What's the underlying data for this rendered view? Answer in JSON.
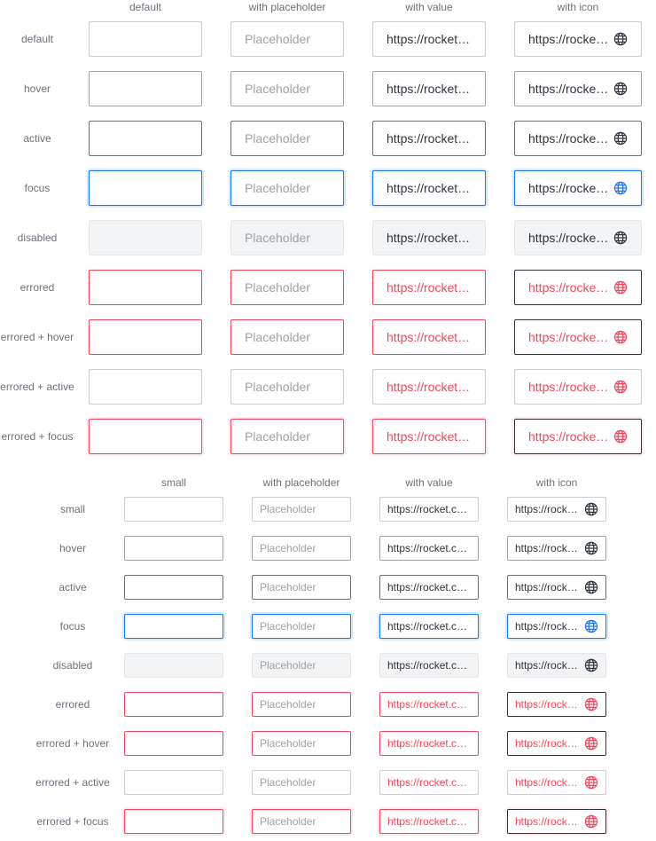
{
  "large": {
    "columns": [
      "default",
      "with placeholder",
      "with value",
      "with icon"
    ],
    "rows": [
      {
        "label": "default",
        "state": "default"
      },
      {
        "label": "hover",
        "state": "hover"
      },
      {
        "label": "active",
        "state": "active"
      },
      {
        "label": "focus",
        "state": "focus"
      },
      {
        "label": "disabled",
        "state": "disabled"
      },
      {
        "label": "errored",
        "state": "errored"
      },
      {
        "label": "errored + hover",
        "state": "errored-hover"
      },
      {
        "label": "errored + active",
        "state": "errored-active"
      },
      {
        "label": "errored + focus",
        "state": "errored-focus"
      }
    ]
  },
  "small": {
    "columns": [
      "small",
      "with placeholder",
      "with value",
      "with icon"
    ],
    "rows": [
      {
        "label": "small",
        "state": "default"
      },
      {
        "label": "hover",
        "state": "hover"
      },
      {
        "label": "active",
        "state": "active"
      },
      {
        "label": "focus",
        "state": "focus"
      },
      {
        "label": "disabled",
        "state": "disabled"
      },
      {
        "label": "errored",
        "state": "errored"
      },
      {
        "label": "errored + hover",
        "state": "errored-hover"
      },
      {
        "label": "errored + active",
        "state": "errored-active"
      },
      {
        "label": "errored + focus",
        "state": "errored-focus"
      }
    ]
  },
  "placeholder_text": "Placeholder",
  "value_text": "https://rocket.chat",
  "icon": "globe-icon",
  "colors": {
    "focus_border": "#1d74f5",
    "error": "#f5455c",
    "disabled_bg": "#f2f3f5",
    "label": "#6c727a"
  }
}
